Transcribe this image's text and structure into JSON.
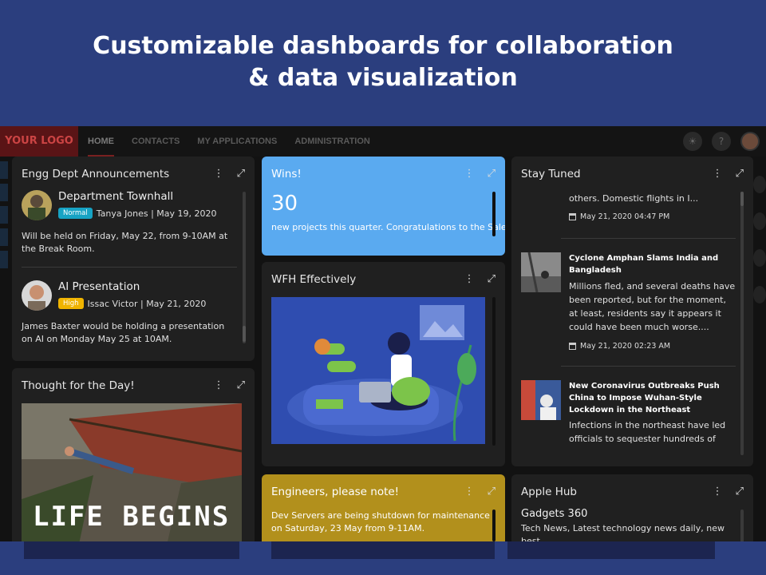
{
  "hero": {
    "line1": "Customizable dashboards for collaboration",
    "line2": "& data visualization"
  },
  "topbar": {
    "logo": "YOUR LOGO",
    "nav": [
      "HOME",
      "CONTACTS",
      "MY APPLICATIONS",
      "ADMINISTRATION"
    ],
    "icons": [
      "sun-icon",
      "help-icon",
      "user-avatar"
    ]
  },
  "cards": {
    "announcements": {
      "title": "Engg Dept Announcements",
      "items": [
        {
          "title": "Department Townhall",
          "badge": "Normal",
          "meta": "Tanya Jones | May 19, 2020",
          "body": "Will be held on Friday, May 22, from 9-10AM at the Break Room."
        },
        {
          "title": "AI Presentation",
          "badge": "High",
          "meta": "Issac Victor | May 21, 2020",
          "body": "James Baxter would be holding a presentation on AI on Monday May 25 at 10AM."
        }
      ]
    },
    "thought": {
      "title": "Thought for the Day!",
      "poster_text": "LIFE BEGINS"
    },
    "wins": {
      "title": "Wins!",
      "value": "30",
      "text": "new projects this quarter. Congratulations to the Sales"
    },
    "wfh": {
      "title": "WFH Effectively"
    },
    "engineers": {
      "title": "Engineers, please note!",
      "text": "Dev Servers are being shutdown for maintenance on Saturday, 23 May from 9-11AM."
    },
    "stay_tuned": {
      "title": "Stay Tuned",
      "items": [
        {
          "headline": "",
          "body": "others. Domestic flights in I...",
          "date": "May 21, 2020 04:47 PM"
        },
        {
          "headline": "Cyclone Amphan Slams India and Bangladesh",
          "body": "Millions fled, and several deaths have been reported, but for the moment, at least, residents say it appears it could have been much worse....",
          "date": "May 21, 2020 02:23 AM"
        },
        {
          "headline": "New Coronavirus Outbreaks Push China to Impose Wuhan-Style Lockdown in the Northeast",
          "body": "Infections in the northeast have led officials to sequester hundreds of",
          "date": ""
        }
      ]
    },
    "apple_hub": {
      "title": "Apple Hub",
      "subtitle": "Gadgets 360",
      "text": "Tech News, Latest technology news daily, new best"
    }
  },
  "tools": {
    "menu": "⋮",
    "expand": "⤢"
  }
}
